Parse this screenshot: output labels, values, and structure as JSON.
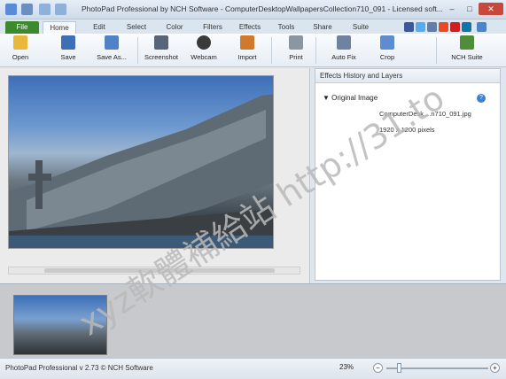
{
  "window": {
    "title": "PhotoPad Professional by NCH Software - ComputerDesktopWallpapersCollection710_091 - Licensed soft...",
    "minimize_glyph": "–",
    "maximize_glyph": "□",
    "close_glyph": "✕",
    "close_color": "#c9483c"
  },
  "ribbon": {
    "tabs": [
      "File",
      "Home",
      "Edit",
      "Select",
      "Color",
      "Filters",
      "Effects",
      "Tools",
      "Share",
      "Suite"
    ],
    "active_tab": "Home",
    "file_tab_color": "#3b8a2e"
  },
  "toolbar": {
    "open": "Open",
    "save": "Save",
    "save_as": "Save As...",
    "screenshot": "Screenshot",
    "webcam": "Webcam",
    "import": "Import",
    "print": "Print",
    "auto_fix": "Auto Fix",
    "crop": "Crop",
    "nch_suite": "NCH Suite"
  },
  "panel": {
    "title": "Effects History and Layers",
    "group": "Original Image",
    "help": "?",
    "file_name": "ComputerDesk....n710_091.jpg",
    "dimensions": "1920 x 1200 pixels"
  },
  "status": {
    "text": "PhotoPad Professional v 2.73 © NCH Software",
    "zoom": "23%",
    "zoom_out": "−",
    "zoom_in": "+"
  },
  "watermark": {
    "text": "xyz軟體補給站 http://31.to",
    "color": "#b9b9b9"
  },
  "icons": {
    "open": "folder-open-icon",
    "save": "floppy-disk-icon",
    "save_as": "save-as-icon",
    "screenshot": "screenshot-icon",
    "webcam": "webcam-icon",
    "import": "import-icon",
    "print": "printer-icon",
    "auto_fix": "magic-wand-icon",
    "crop": "crop-icon",
    "nch_suite": "nch-suite-icon"
  }
}
